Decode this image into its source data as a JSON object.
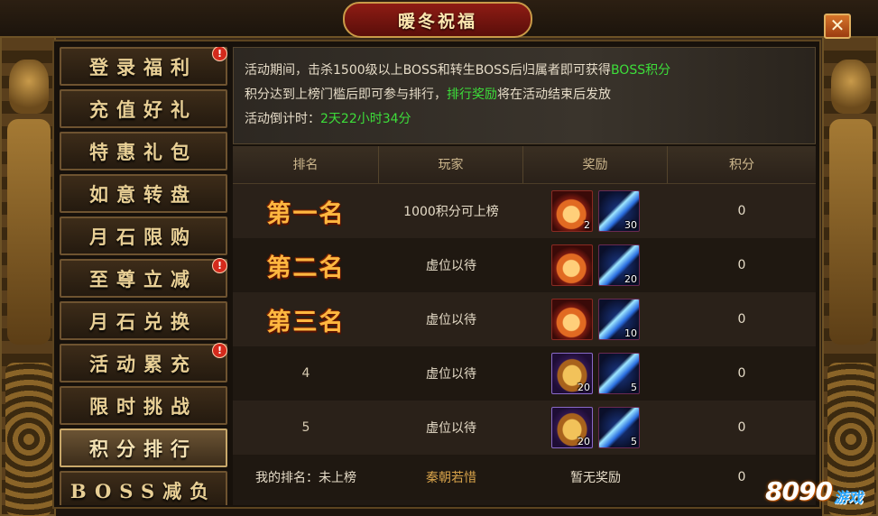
{
  "window": {
    "title": "暖冬祝福",
    "close_label": "✕"
  },
  "sidebar": {
    "items": [
      {
        "label": "登录福利",
        "badge": "!"
      },
      {
        "label": "充值好礼",
        "badge": ""
      },
      {
        "label": "特惠礼包",
        "badge": ""
      },
      {
        "label": "如意转盘",
        "badge": ""
      },
      {
        "label": "月石限购",
        "badge": ""
      },
      {
        "label": "至尊立减",
        "badge": "!"
      },
      {
        "label": "月石兑换",
        "badge": ""
      },
      {
        "label": "活动累充",
        "badge": "!"
      },
      {
        "label": "限时挑战",
        "badge": ""
      },
      {
        "label": "积分排行",
        "badge": "",
        "active": true
      },
      {
        "label": "BOSS减负",
        "badge": ""
      }
    ]
  },
  "info": {
    "line1_prefix": "活动期间，击杀1500级以上BOSS和转生BOSS后归属者即可获得",
    "line1_highlight": "BOSS积分",
    "line2_prefix": "积分达到上榜门槛后即可参与排行，",
    "line2_highlight": "排行奖励",
    "line2_suffix": "将在活动结束后发放",
    "line3_prefix": "活动倒计时：",
    "line3_highlight": "2天22小时34分"
  },
  "table": {
    "headers": [
      "排名",
      "玩家",
      "奖励",
      "积分"
    ],
    "rows": [
      {
        "rank": "第一名",
        "player_highlight": "1000积分",
        "player": "可上榜",
        "rewards": [
          {
            "icon": "potion-icon",
            "count": "2"
          },
          {
            "icon": "crystal-icon",
            "count": "30"
          }
        ],
        "score": "0"
      },
      {
        "rank": "第二名",
        "player_highlight": "",
        "player": "虚位以待",
        "rewards": [
          {
            "icon": "potion-icon",
            "count": ""
          },
          {
            "icon": "crystal-icon",
            "count": "20"
          }
        ],
        "score": "0"
      },
      {
        "rank": "第三名",
        "player_highlight": "",
        "player": "虚位以待",
        "rewards": [
          {
            "icon": "potion-icon",
            "count": ""
          },
          {
            "icon": "crystal-icon",
            "count": "10"
          }
        ],
        "score": "0"
      },
      {
        "rank": "4",
        "player_highlight": "",
        "player": "虚位以待",
        "rewards": [
          {
            "icon": "chest-icon",
            "count": "20"
          },
          {
            "icon": "crystal-icon",
            "count": "5"
          }
        ],
        "score": "0"
      },
      {
        "rank": "5",
        "player_highlight": "",
        "player": "虚位以待",
        "rewards": [
          {
            "icon": "chest-icon",
            "count": "20"
          },
          {
            "icon": "crystal-icon",
            "count": "5"
          }
        ],
        "score": "0"
      }
    ],
    "footer": {
      "my_rank": "我的排名：未上榜",
      "my_name": "秦朝若惜",
      "my_reward": "暂无奖励",
      "my_score": "0"
    }
  },
  "watermark": {
    "logo_main": "8090",
    "logo_sub": "游戏"
  },
  "colors": {
    "highlight_green": "#3dde3a",
    "rank_gold": "#ffb740",
    "badge_red": "#d42a1c",
    "name_gold": "#d6a24a"
  }
}
